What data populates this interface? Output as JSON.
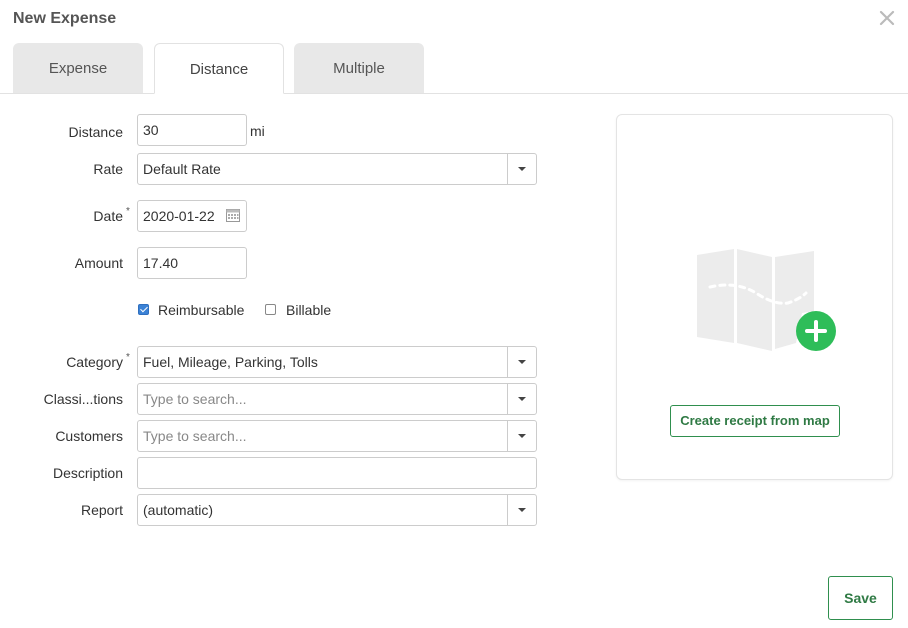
{
  "dialog": {
    "title": "New Expense"
  },
  "tabs": [
    {
      "label": "Expense"
    },
    {
      "label": "Distance"
    },
    {
      "label": "Multiple"
    }
  ],
  "form": {
    "distance": {
      "label": "Distance",
      "value": "30",
      "unit": "mi"
    },
    "rate": {
      "label": "Rate",
      "value": "Default Rate"
    },
    "date": {
      "label": "Date",
      "required": "*",
      "value": "2020-01-22"
    },
    "amount": {
      "label": "Amount",
      "value": "17.40"
    },
    "reimbursable": {
      "label": "Reimbursable",
      "checked": true
    },
    "billable": {
      "label": "Billable",
      "checked": false
    },
    "category": {
      "label": "Category",
      "required": "*",
      "value": "Fuel, Mileage, Parking, Tolls"
    },
    "classifications": {
      "label": "Classi...tions",
      "placeholder": "Type to search..."
    },
    "customers": {
      "label": "Customers",
      "placeholder": "Type to search..."
    },
    "description": {
      "label": "Description",
      "value": ""
    },
    "report": {
      "label": "Report",
      "value": "(automatic)"
    }
  },
  "receipt": {
    "button_label": "Create receipt from map"
  },
  "footer": {
    "save_label": "Save"
  },
  "colors": {
    "accent_green": "#2ebd59",
    "checkbox_blue": "#3b82d6"
  }
}
